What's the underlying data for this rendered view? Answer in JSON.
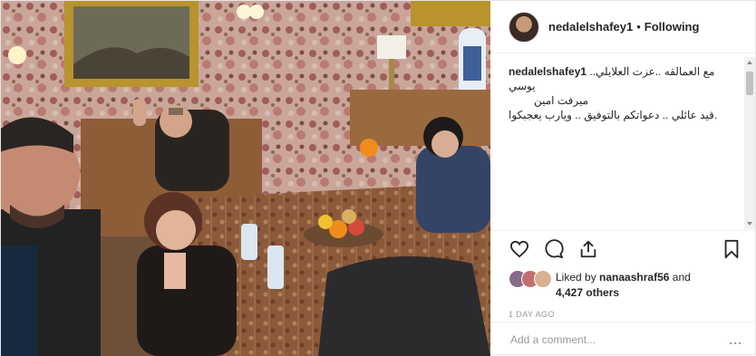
{
  "post": {
    "username": "nedalelshafey1",
    "separator": "•",
    "follow_label": "Following",
    "caption": {
      "username": "nedalelshafey1",
      "line1": "مع العمالقه ..عزت العلايلي.. يوسي",
      "line2": "ميرفت امين",
      "line3": ".قيد عائلي .. دعواتكم بالتوفيق .. ويارب يعجبكوا"
    },
    "likes": {
      "prefix": "Liked by",
      "user": "nanaashraf56",
      "and": "and",
      "others": "4,427 others"
    },
    "time": "1 DAY AGO",
    "comment_placeholder": "Add a comment...",
    "more_label": "..."
  },
  "icons": {
    "like": "heart-icon",
    "comment": "comment-bubble-icon",
    "share": "share-icon",
    "save": "bookmark-icon"
  },
  "colors": {
    "text": "#262626",
    "muted": "#999999",
    "border": "#efefef"
  }
}
